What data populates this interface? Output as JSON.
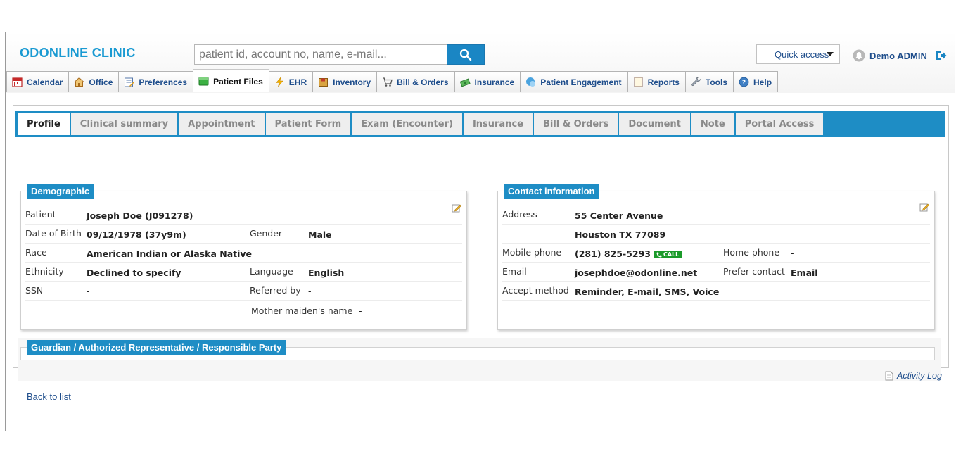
{
  "app": {
    "title": "ODONLINE CLINIC"
  },
  "search": {
    "placeholder": "patient id, account no, name, e-mail...",
    "button_icon": "search-icon"
  },
  "quick_access": {
    "label": "Quick access"
  },
  "user": {
    "name": "Demo ADMIN",
    "bell_icon": "bell-icon",
    "logout_icon": "logout-icon"
  },
  "main_tabs": [
    {
      "label": "Calendar",
      "icon": "calendar-icon"
    },
    {
      "label": "Office",
      "icon": "home-icon"
    },
    {
      "label": "Preferences",
      "icon": "preferences-icon"
    },
    {
      "label": "Patient Files",
      "icon": "folder-icon",
      "active": true
    },
    {
      "label": "EHR",
      "icon": "lightning-icon"
    },
    {
      "label": "Inventory",
      "icon": "box-icon"
    },
    {
      "label": "Bill & Orders",
      "icon": "cart-icon"
    },
    {
      "label": "Insurance",
      "icon": "money-icon"
    },
    {
      "label": "Patient Engagement",
      "icon": "engagement-icon"
    },
    {
      "label": "Reports",
      "icon": "report-icon"
    },
    {
      "label": "Tools",
      "icon": "wrench-icon"
    },
    {
      "label": "Help",
      "icon": "help-icon"
    }
  ],
  "sub_tabs": [
    {
      "label": "Profile",
      "active": true
    },
    {
      "label": "Clinical summary"
    },
    {
      "label": "Appointment"
    },
    {
      "label": "Patient Form"
    },
    {
      "label": "Exam (Encounter)"
    },
    {
      "label": "Insurance"
    },
    {
      "label": "Bill & Orders"
    },
    {
      "label": "Document"
    },
    {
      "label": "Note"
    },
    {
      "label": "Portal Access"
    }
  ],
  "demographic": {
    "title": "Demographic",
    "patient_label": "Patient",
    "patient_value": "Joseph Doe (J091278)",
    "dob_label": "Date of Birth",
    "dob_value": "09/12/1978 (37y9m)",
    "gender_label": "Gender",
    "gender_value": "Male",
    "race_label": "Race",
    "race_value": "American Indian or Alaska Native",
    "ethnicity_label": "Ethnicity",
    "ethnicity_value": "Declined to specify",
    "language_label": "Language",
    "language_value": "English",
    "ssn_label": "SSN",
    "ssn_value": "-",
    "referred_label": "Referred by",
    "referred_value": "-",
    "mother_label": "Mother maiden's name",
    "mother_value": "-"
  },
  "contact": {
    "title": "Contact information",
    "address_label": "Address",
    "address_line1": "55 Center Avenue",
    "address_line2": "Houston TX 77089",
    "mobile_label": "Mobile phone",
    "mobile_value": "(281) 825-5293",
    "call_label": "CALL",
    "home_label": "Home phone",
    "home_value": "-",
    "email_label": "Email",
    "email_value": "josephdoe@odonline.net",
    "prefer_label": "Prefer contact",
    "prefer_value": "Email",
    "accept_label": "Accept method",
    "accept_value": "Reminder, E-mail, SMS, Voice"
  },
  "guardian": {
    "title": "Guardian / Authorized Representative / Responsible Party"
  },
  "footer": {
    "activity_log": "Activity Log",
    "back": "Back to list"
  },
  "colors": {
    "accent": "#1e8dc5",
    "link": "#1f4e8c",
    "logo": "#1a9ad2",
    "call_green": "#1b9a2a"
  }
}
